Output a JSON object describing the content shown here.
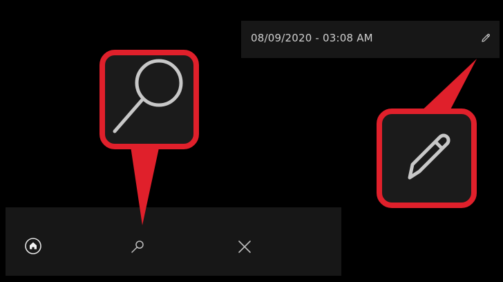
{
  "datetime": "08/09/2020 - 03:08 AM",
  "icons": {
    "edit_small": "pencil-icon",
    "nav_home": "home-icon",
    "nav_search": "search-icon",
    "nav_close": "close-icon",
    "callout_search": "search-icon",
    "callout_edit": "pencil-icon"
  },
  "colors": {
    "background": "#000000",
    "panel": "#171717",
    "text": "#cfcfcf",
    "icon": "#bfbfbf",
    "callout_border": "#e0202b",
    "callout_fill": "#1b1b1b"
  }
}
